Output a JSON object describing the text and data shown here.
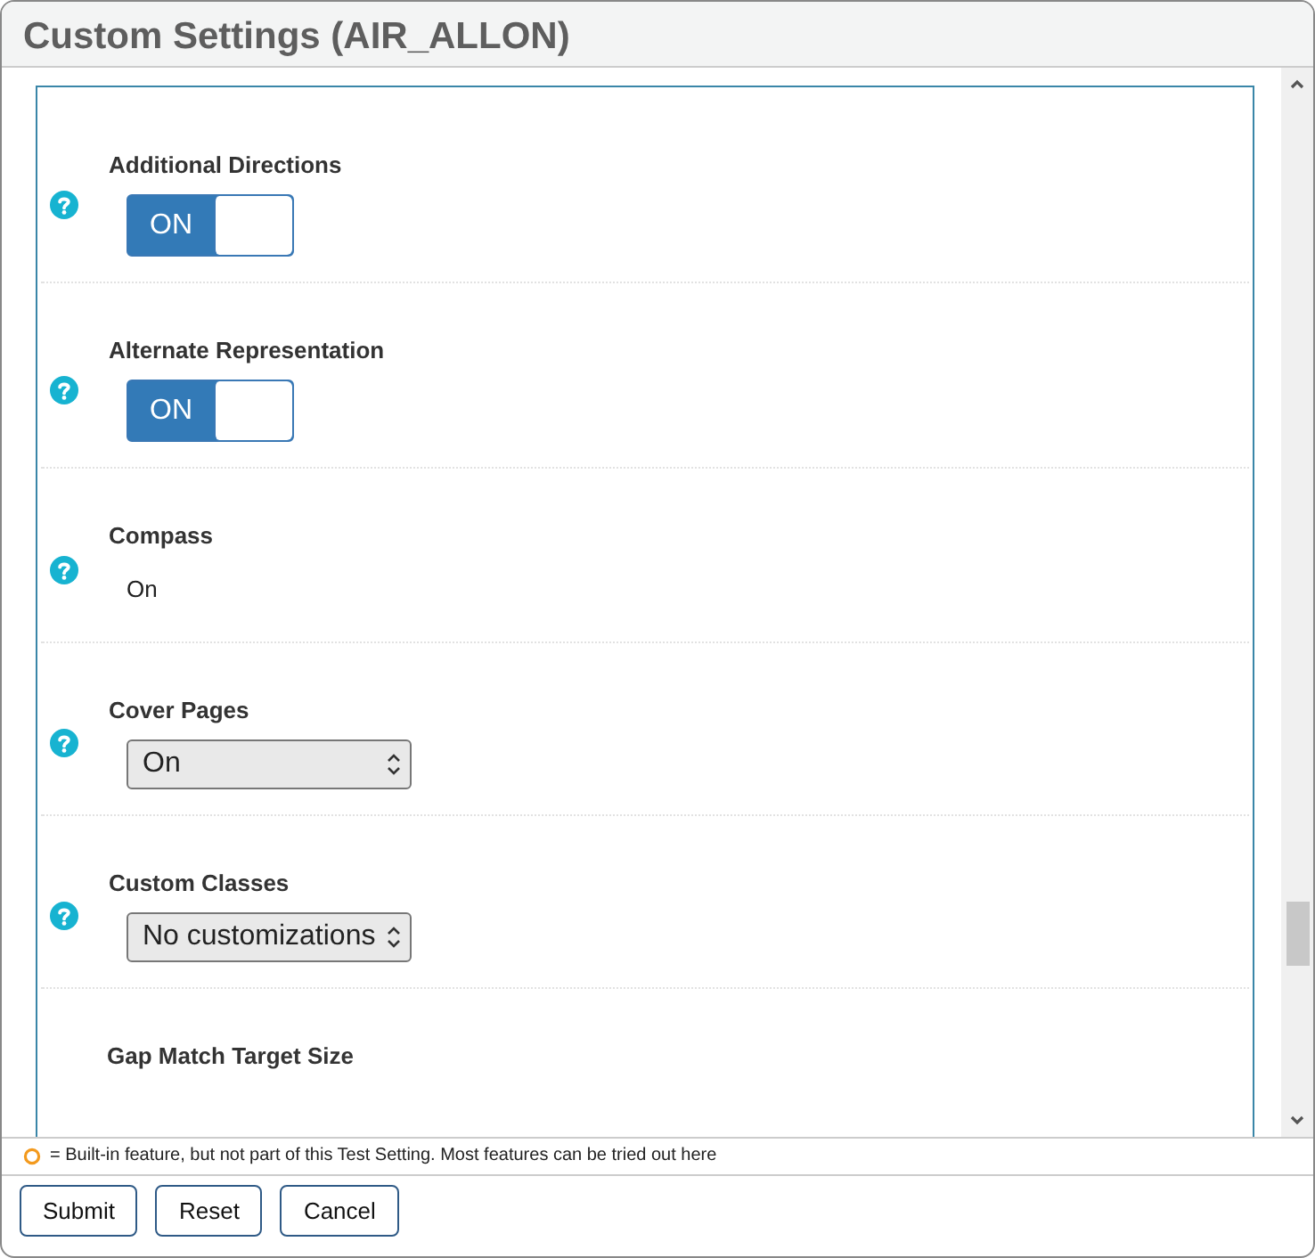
{
  "window": {
    "title": "Custom Settings (AIR_ALLON)"
  },
  "settings": [
    {
      "label": "Additional Directions",
      "kind": "toggle",
      "on": true,
      "value": "ON"
    },
    {
      "label": "Alternate Representation",
      "kind": "toggle",
      "on": true,
      "value": "ON"
    },
    {
      "label": "Compass",
      "kind": "text",
      "value": "On"
    },
    {
      "label": "Cover Pages",
      "kind": "select",
      "value": "On"
    },
    {
      "label": "Custom Classes",
      "kind": "select",
      "value": "No customizations"
    },
    {
      "label": "Gap Match Target Size",
      "kind": "partial"
    }
  ],
  "legend": "= Built-in feature, but not part of this Test Setting. Most features can be tried out here",
  "buttons": [
    "Submit",
    "Reset",
    "Cancel"
  ]
}
